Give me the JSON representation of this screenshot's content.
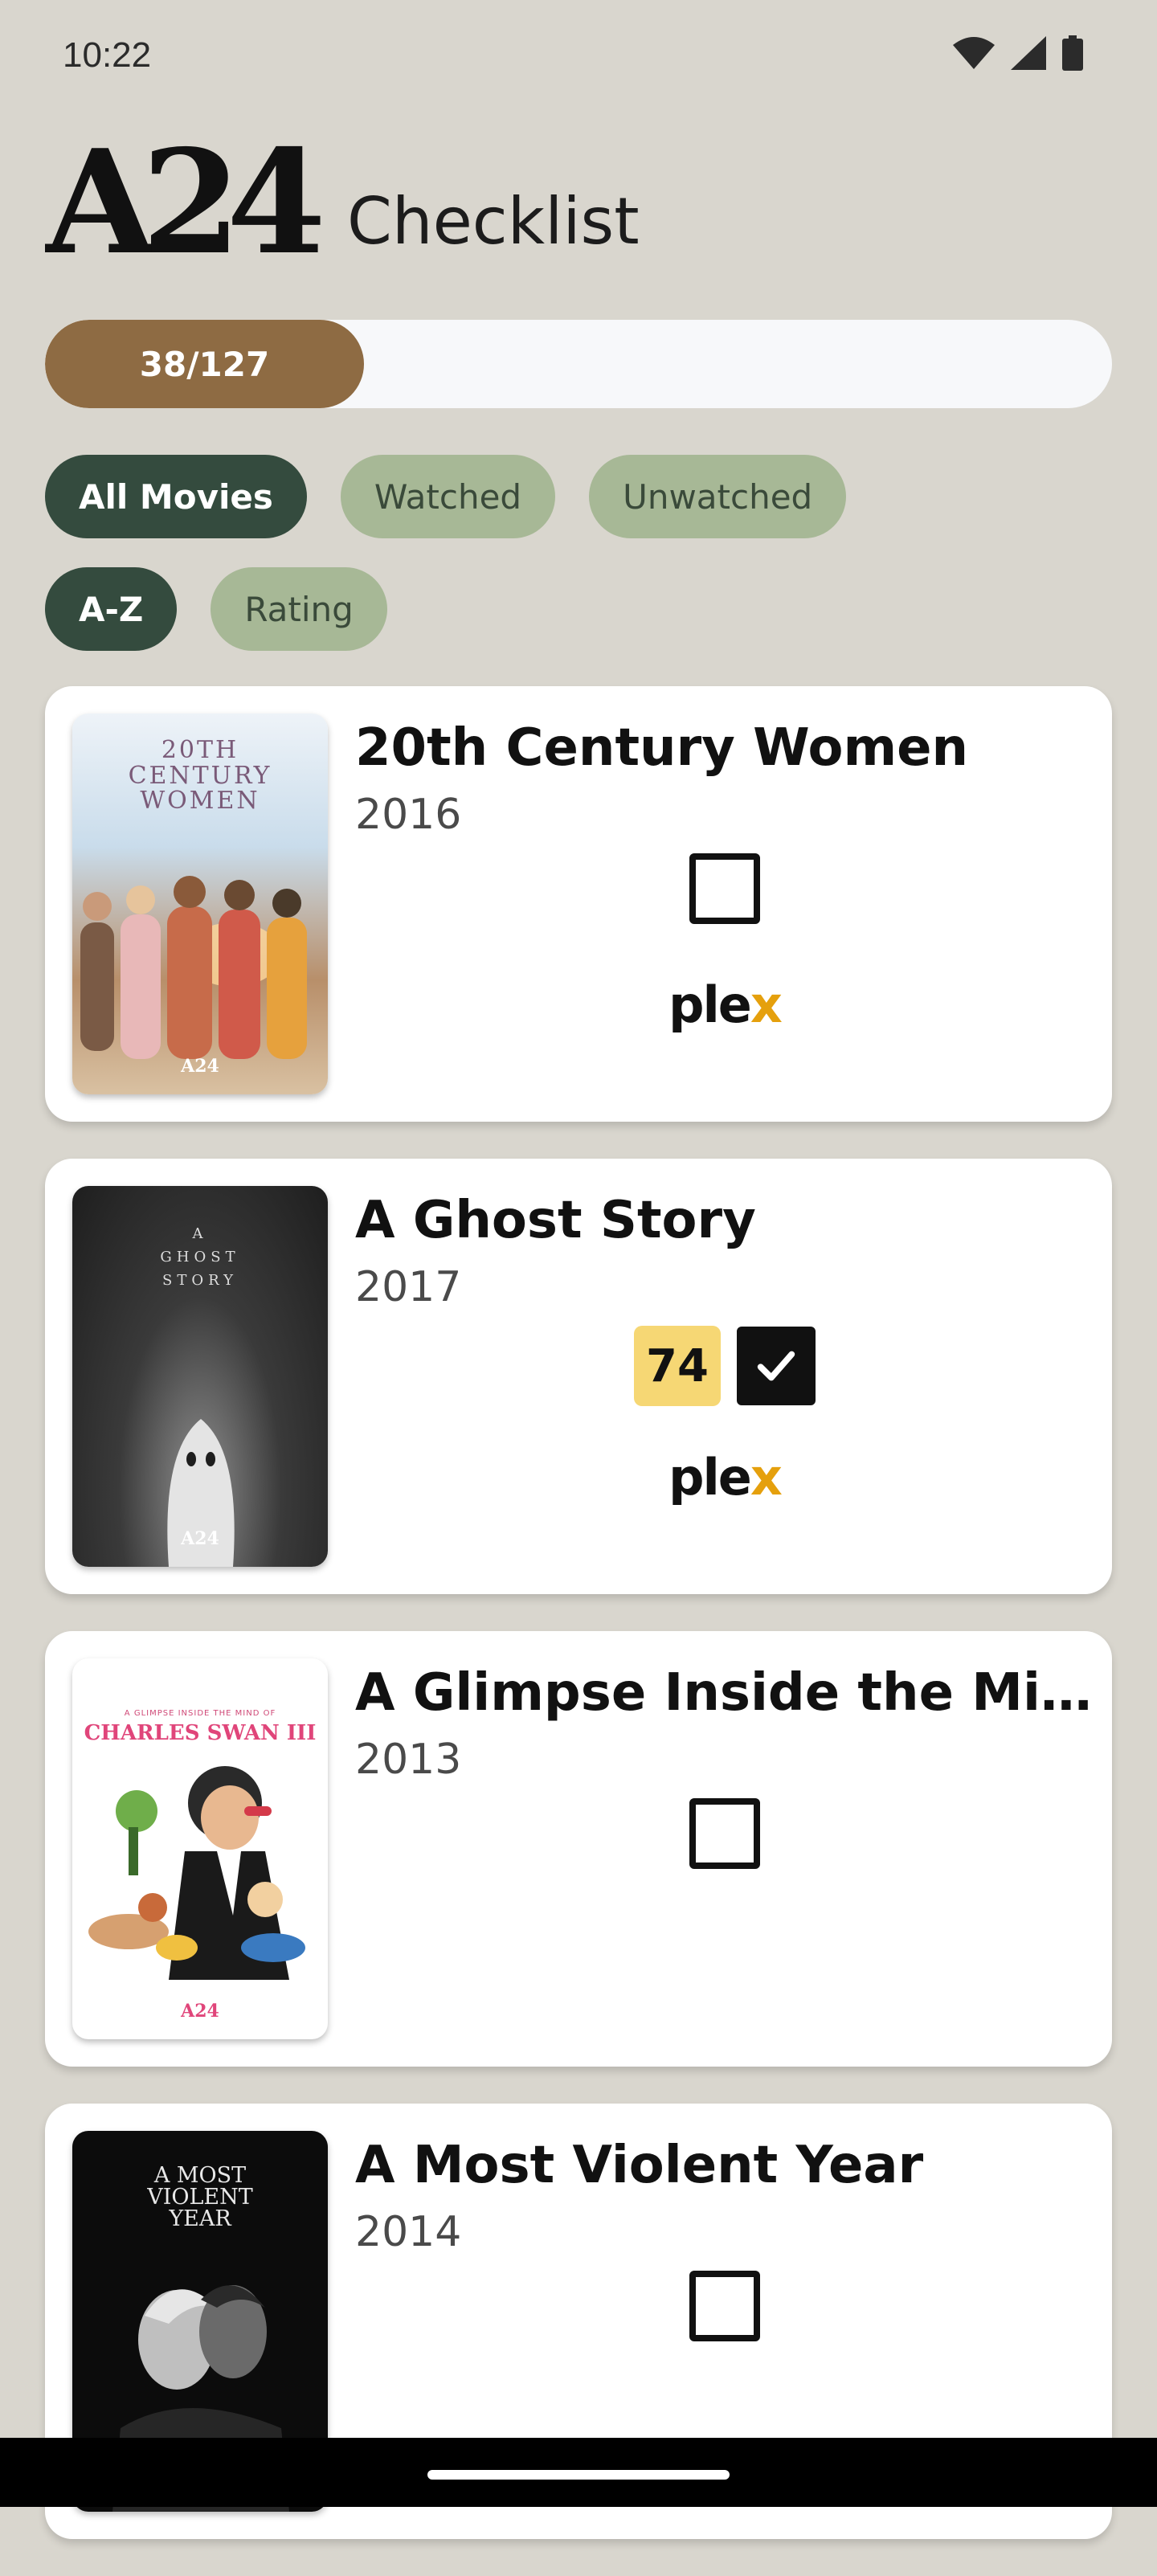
{
  "status_bar": {
    "time": "10:22"
  },
  "header": {
    "brand": "A24",
    "title": "Checklist"
  },
  "progress": {
    "label": "38/127",
    "watched": 38,
    "total": 127
  },
  "filters": [
    {
      "label": "All Movies",
      "selected": true
    },
    {
      "label": "Watched",
      "selected": false
    },
    {
      "label": "Unwatched",
      "selected": false
    }
  ],
  "sorts": [
    {
      "label": "A-Z",
      "selected": true
    },
    {
      "label": "Rating",
      "selected": false
    }
  ],
  "movies": [
    {
      "title": "20th Century Women",
      "year": "2016",
      "watched": false,
      "rating": null,
      "plex": "plex",
      "poster_text": "20TH\nCENTURY\nWOMEN",
      "poster_brand": "A24"
    },
    {
      "title": "A Ghost Story",
      "year": "2017",
      "watched": true,
      "rating": "74",
      "plex": "plex",
      "poster_text": "A\nGHOST\nSTORY",
      "poster_brand": "A24"
    },
    {
      "title": "A Glimpse Inside the Min…",
      "year": "2013",
      "watched": false,
      "rating": null,
      "plex": null,
      "poster_kicker": "A GLIMPSE INSIDE THE MIND OF",
      "poster_text": "CHARLES SWAN III",
      "poster_brand": "A24"
    },
    {
      "title": "A Most Violent Year",
      "year": "2014",
      "watched": false,
      "rating": null,
      "plex": null,
      "poster_text": "A MOST\nVIOLENT\nYEAR",
      "poster_brand": ""
    }
  ],
  "colors": {
    "background": "#d9d6ce",
    "progress_fill": "#8e6b43",
    "chip_selected": "#344b3e",
    "chip_unselected": "#a7b896",
    "rating_badge": "#f6d774",
    "plex_accent": "#e5a00d"
  },
  "icons": {
    "wifi": "wifi-icon",
    "signal": "signal-icon",
    "battery": "battery-icon",
    "check": "check-icon"
  }
}
